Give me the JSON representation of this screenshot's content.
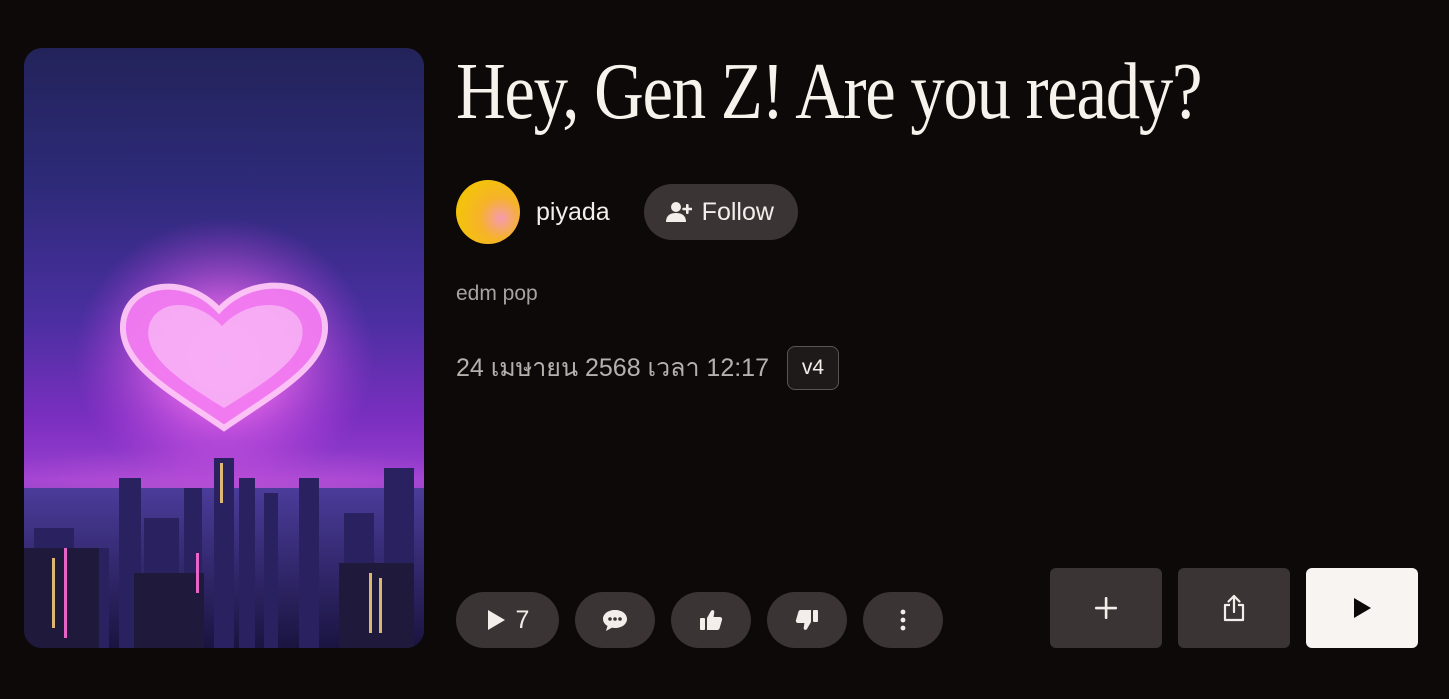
{
  "song": {
    "title": "Hey, Gen Z! Are you ready?",
    "genre": "edm pop",
    "date": "24 เมษายน 2568 เวลา 12:17",
    "version": "v4"
  },
  "creator": {
    "username": "piyada",
    "follow_label": "Follow"
  },
  "actions": {
    "play_count": "7",
    "icons": [
      "play-icon",
      "comment-icon",
      "thumbs-up-icon",
      "thumbs-down-icon",
      "more-icon",
      "plus-icon",
      "share-icon",
      "play-icon"
    ]
  },
  "colors": {
    "background": "#0d0909",
    "button": "#3a3534",
    "primary_button": "#f8f4f1"
  }
}
